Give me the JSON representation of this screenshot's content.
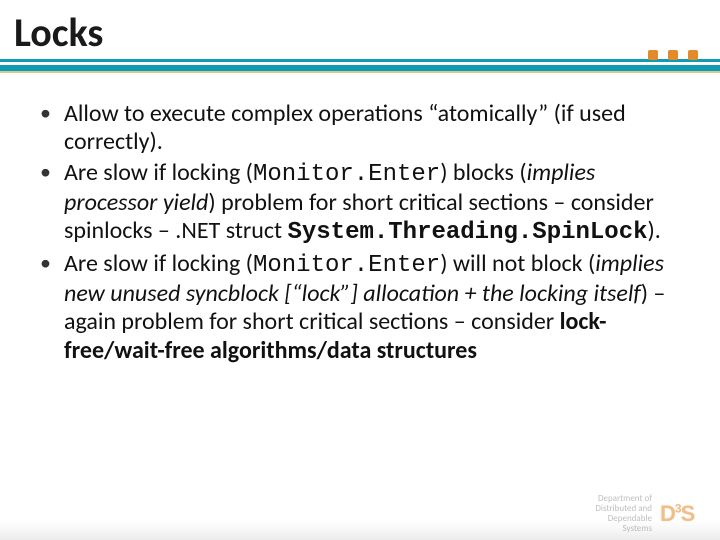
{
  "title": "Locks",
  "bullets": [
    {
      "segments": [
        {
          "text": "Allow to execute complex operations “atomically” (if used correctly).",
          "style": ""
        }
      ]
    },
    {
      "segments": [
        {
          "text": "Are slow if locking (",
          "style": ""
        },
        {
          "text": "Monitor.Enter",
          "style": "mono"
        },
        {
          "text": ") blocks (",
          "style": ""
        },
        {
          "text": "implies processor yield",
          "style": "ital"
        },
        {
          "text": ") problem for short critical sections – consider spinlocks – .NET struct ",
          "style": ""
        },
        {
          "text": "System.Threading.SpinLock",
          "style": "mono bold"
        },
        {
          "text": ").",
          "style": ""
        }
      ]
    },
    {
      "segments": [
        {
          "text": "Are slow if locking (",
          "style": ""
        },
        {
          "text": "Monitor.Enter",
          "style": "mono"
        },
        {
          "text": ") will not block (",
          "style": ""
        },
        {
          "text": "implies new unused syncblock [“lock”] allocation + the locking itself",
          "style": "ital"
        },
        {
          "text": ") – again problem for short critical sections – consider ",
          "style": ""
        },
        {
          "text": "lock-free/wait-free algorithms/data structures",
          "style": "bold"
        }
      ]
    }
  ],
  "footer": {
    "line1": "Department of",
    "line2": "Distributed and",
    "line3": "Dependable",
    "line4": "Systems",
    "logo": "D3S"
  }
}
